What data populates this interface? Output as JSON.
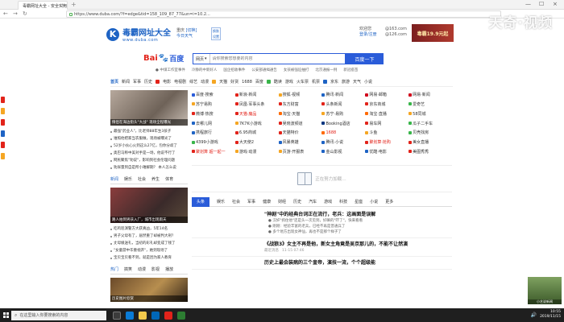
{
  "browser": {
    "tab_title": "毒霸网址大全 - 安全实用",
    "url": "https://www.duba.com/?f=edge&tid=158_109_87_77&un=i=10.2...",
    "new_tab": "+",
    "tab_close": "×",
    "back": "←",
    "forward": "→",
    "refresh": "↻",
    "minimize": "—",
    "maximize": "☐",
    "close": "×"
  },
  "watermark": "天奇·视频",
  "header": {
    "logo_letter": "K",
    "logo_cn": "毒霸网址大全",
    "logo_en": "www.duba.com",
    "location_city": "重庆",
    "location_change": "[切换]",
    "location_weather": "今日天气",
    "change_skin": "换肤 设置",
    "user_line1": "欢迎您",
    "user_line2": "登录/注册",
    "mail_line1": "@163.com",
    "mail_line2": "@126.com",
    "promo_text": "毒霸19.9元起"
  },
  "search": {
    "baidu_bai": "Bai",
    "baidu_paw": "🐾",
    "baidu_du": "百度",
    "type": "网页",
    "placeholder": "请你搜索您想要的内容",
    "button": "百度一下",
    "hot_links": [
      "● 中煤工作室事件",
      "冷静的中新好人",
      "国企招收事件",
      "公安部通缉通告",
      "女孩被强迫抽打",
      "北京通报一例",
      "新冠疫苗"
    ]
  },
  "navrow": [
    "首页",
    "新闻",
    "军事",
    "历史",
    "电影",
    "电视剧",
    "综艺",
    "动漫",
    "天猫",
    "好货",
    "1688",
    "百度",
    "酷读",
    "游戏",
    "火车票",
    "机票",
    "京东",
    "旅游",
    "天气",
    "小说"
  ],
  "leftcol": {
    "img1_caption": "情侣在海边街头\"大战\" 现场全程曝光",
    "news1": [
      "最强\"药业人\"，比老师88年生3孩子",
      "谁照他把家当衣服做，现场被曝光了",
      "52岁小伙心火到这么27亿，包你分歧了",
      "奥巴马称中美对手是一场，他说不行了",
      "网民聚焦\"劝说\"，影响到社会伦理问题",
      "劝尿量到自是所小难解期？ 本人怎么说"
    ],
    "subtabs1": [
      "新闻",
      "娱乐",
      "社会",
      "养生",
      "体育"
    ],
    "img2_caption": "路人拍到男孩入厂，城市出现雨天",
    "news2": [
      "吃鸡巡演警方大获真凶，5年14名",
      "男子父母有了，居然重了却被判大刑？",
      "丈母娘送礼，当初的彩礼却变成了钱了",
      "\"女童游中华重视开\"，她到现场了",
      "宝贝宝贝看不到，就是因为家人教育"
    ],
    "subtabs2": [
      "热门",
      "搞笑",
      "动漫",
      "影视",
      "播放"
    ],
    "img3_caption": "历史图片欣赏"
  },
  "sitegrid": [
    {
      "label": "百度·搜索",
      "color": "#2a5cd9"
    },
    {
      "label": "新浪·新闻",
      "color": "#e2231a"
    },
    {
      "label": "搜狐·视频",
      "color": "#f5a623"
    },
    {
      "label": "腾讯·新闻",
      "color": "#1e63c4"
    },
    {
      "label": "网易·邮箱",
      "color": "#d0021b"
    },
    {
      "label": "网易·新闻",
      "color": "#d0021b"
    },
    {
      "label": "苏宁易购",
      "color": "#f5a623"
    },
    {
      "label": "凤凰·军事头条",
      "color": "#e2231a"
    },
    {
      "label": "东方财富",
      "color": "#e2231a"
    },
    {
      "label": "头条新闻",
      "color": "#e2231a"
    },
    {
      "label": "京东商城",
      "color": "#e2231a"
    },
    {
      "label": "爱奇艺",
      "color": "#39b54a"
    },
    {
      "label": "微博·热搜",
      "color": "#e2231a"
    },
    {
      "label": "天猫·魔品",
      "color": "#e2231a",
      "red": true
    },
    {
      "label": "淘宝·天猫",
      "color": "#ff6a00"
    },
    {
      "label": "苏宁·易购",
      "color": "#f5a623"
    },
    {
      "label": "淘宝·直播",
      "color": "#ff6a00"
    },
    {
      "label": "58同城",
      "color": "#f5a623"
    },
    {
      "label": "去哪儿网",
      "color": "#1e63c4"
    },
    {
      "label": "7K7K小游戏",
      "color": "#f5a623"
    },
    {
      "label": "吴晓波频道",
      "color": "#e2231a"
    },
    {
      "label": "Booking酒店",
      "color": "#003580"
    },
    {
      "label": "易车网",
      "color": "#e2231a"
    },
    {
      "label": "瓜子二手车",
      "color": "#39b54a"
    },
    {
      "label": "携程旅行",
      "color": "#1e63c4"
    },
    {
      "label": "6.95商城",
      "color": "#e2231a"
    },
    {
      "label": "天猫特价",
      "color": "#e2231a"
    },
    {
      "label": "1688",
      "color": "#ff6a00",
      "red": true
    },
    {
      "label": "斗鱼",
      "color": "#f5a623"
    },
    {
      "label": "贝壳找房",
      "color": "#39b54a"
    },
    {
      "label": "4399小游戏",
      "color": "#39b54a"
    },
    {
      "label": "大天使2",
      "color": "#e2231a"
    },
    {
      "label": "风暴英雄",
      "color": "#1e63c4"
    },
    {
      "label": "腾讯·小说",
      "color": "#1e63c4"
    },
    {
      "label": "聚划算·抢购",
      "color": "#e2231a",
      "red": true
    },
    {
      "label": "美女直播",
      "color": "#e2231a"
    },
    {
      "label": "聚划算 超一起一",
      "color": "#e2231a",
      "red": true
    },
    {
      "label": "游戏·动漫",
      "color": "#f5a623"
    },
    {
      "label": "页游·开服表",
      "color": "#f5a623"
    },
    {
      "label": "金山影视",
      "color": "#1e63c4"
    },
    {
      "label": "优酷·电影",
      "color": "#1e63c4"
    },
    {
      "label": "美图秀秀",
      "color": "#e2231a"
    }
  ],
  "loading_text": "正在努力加载…",
  "feedtabs": [
    "头条",
    "娱乐",
    "社会",
    "军事",
    "健康",
    "财经",
    "历史",
    "汽车",
    "游戏",
    "科技",
    "星座",
    "小说",
    "更多"
  ],
  "feed": [
    {
      "title": "\"神剧\"中的经典台词正在流行，老兵：这画面是误解",
      "subs": [
        "● 汉奸\"抓住他\"还是头一次见到，好嘛的\"吓了\"，快来看看",
        "● 刚刚：经验丰富的老兵，已经不再是普通兵了",
        "● 多个地方出现女神仙，再也不是那个样子了"
      ],
      "meta_src": "",
      "meta_time": ""
    },
    {
      "title": "《战狼3》女主不再是他，新女主角竟是吴京那儿的，不能不让然演",
      "subs": [],
      "meta_src": "最近消息",
      "meta_time": "11-15 07:46"
    },
    {
      "title": "历史上最会装病的三个皇帝，演技一流，个个超级能",
      "subs": [],
      "meta_src": "",
      "meta_time": ""
    }
  ],
  "video_label": "小艺说新闻",
  "taskbar": {
    "search_text": "在这里输入你要搜索的内容",
    "time": "10:55",
    "date": "2019/11/15",
    "tray": "🔊"
  }
}
